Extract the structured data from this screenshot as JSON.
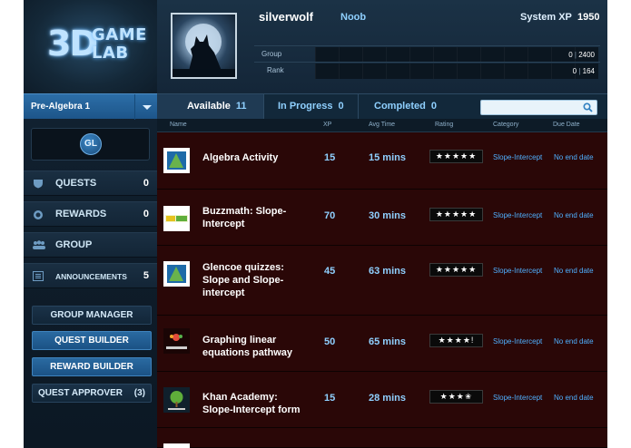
{
  "logo": {
    "big": "3D",
    "line1": "GAME",
    "line2": "LAB"
  },
  "course": {
    "selected": "Pre-Algebra 1"
  },
  "gl_badge": "GL",
  "nav": [
    {
      "label": "QUESTS",
      "count": "0",
      "icon": "shield-icon"
    },
    {
      "label": "REWARDS",
      "count": "0",
      "icon": "badge-icon"
    },
    {
      "label": "GROUP",
      "count": "",
      "icon": "group-icon"
    },
    {
      "label": "ANNOUNCEMENTS",
      "count": "5",
      "icon": "announcement-icon"
    }
  ],
  "admin": {
    "group_manager": "GROUP MANAGER",
    "quest_builder": "QUEST BUILDER",
    "reward_builder": "REWARD BUILDER",
    "quest_approver": "QUEST APPROVER",
    "quest_approver_count": "(3)"
  },
  "user": {
    "name": "silverwolf",
    "level": "Noob",
    "xp_label": "System XP",
    "xp_value": "1950"
  },
  "stats": [
    {
      "label": "Group",
      "value": "0",
      "total": "2400"
    },
    {
      "label": "Rank",
      "value": "0",
      "total": "164"
    }
  ],
  "tabs": [
    {
      "label": "Available",
      "count": "11"
    },
    {
      "label": "In Progress",
      "count": "0"
    },
    {
      "label": "Completed",
      "count": "0"
    }
  ],
  "search": {
    "placeholder": ""
  },
  "columns": {
    "name": "Name",
    "xp": "XP",
    "avg_time": "Avg Time",
    "rating": "Rating",
    "category": "Category",
    "due_date": "Due Date"
  },
  "quests": [
    {
      "title": "Algebra Activity",
      "xp": "15",
      "time": "15 mins",
      "rating": "★★★★★",
      "category": "Slope-Intercept",
      "due": "No end date",
      "thumb": "algebra-activity-thumb"
    },
    {
      "title": "Buzzmath: Slope-Intercept",
      "xp": "70",
      "time": "30 mins",
      "rating": "★★★★★",
      "category": "Slope-Intercept",
      "due": "No end date",
      "thumb": "buzzmath-thumb"
    },
    {
      "title": "Glencoe quizzes: Slope and Slope-intercept",
      "xp": "45",
      "time": "63 mins",
      "rating": "★★★★★",
      "category": "Slope-Intercept",
      "due": "No end date",
      "thumb": "glencoe-thumb"
    },
    {
      "title": "Graphing linear equations pathway",
      "xp": "50",
      "time": "65 mins",
      "rating": "★★★★!",
      "category": "Slope-Intercept",
      "due": "No end date",
      "thumb": "sophia-thumb"
    },
    {
      "title": "Khan Academy: Slope-Intercept form",
      "xp": "15",
      "time": "28 mins",
      "rating": "★★★✬",
      "category": "Slope-Intercept",
      "due": "No end date",
      "thumb": "khan-academy-thumb"
    }
  ],
  "colors": {
    "accent": "#8fd0ff",
    "link": "#4fb0ff",
    "row_bg": "#2a0707",
    "sidebar_bg": "#16283a"
  }
}
